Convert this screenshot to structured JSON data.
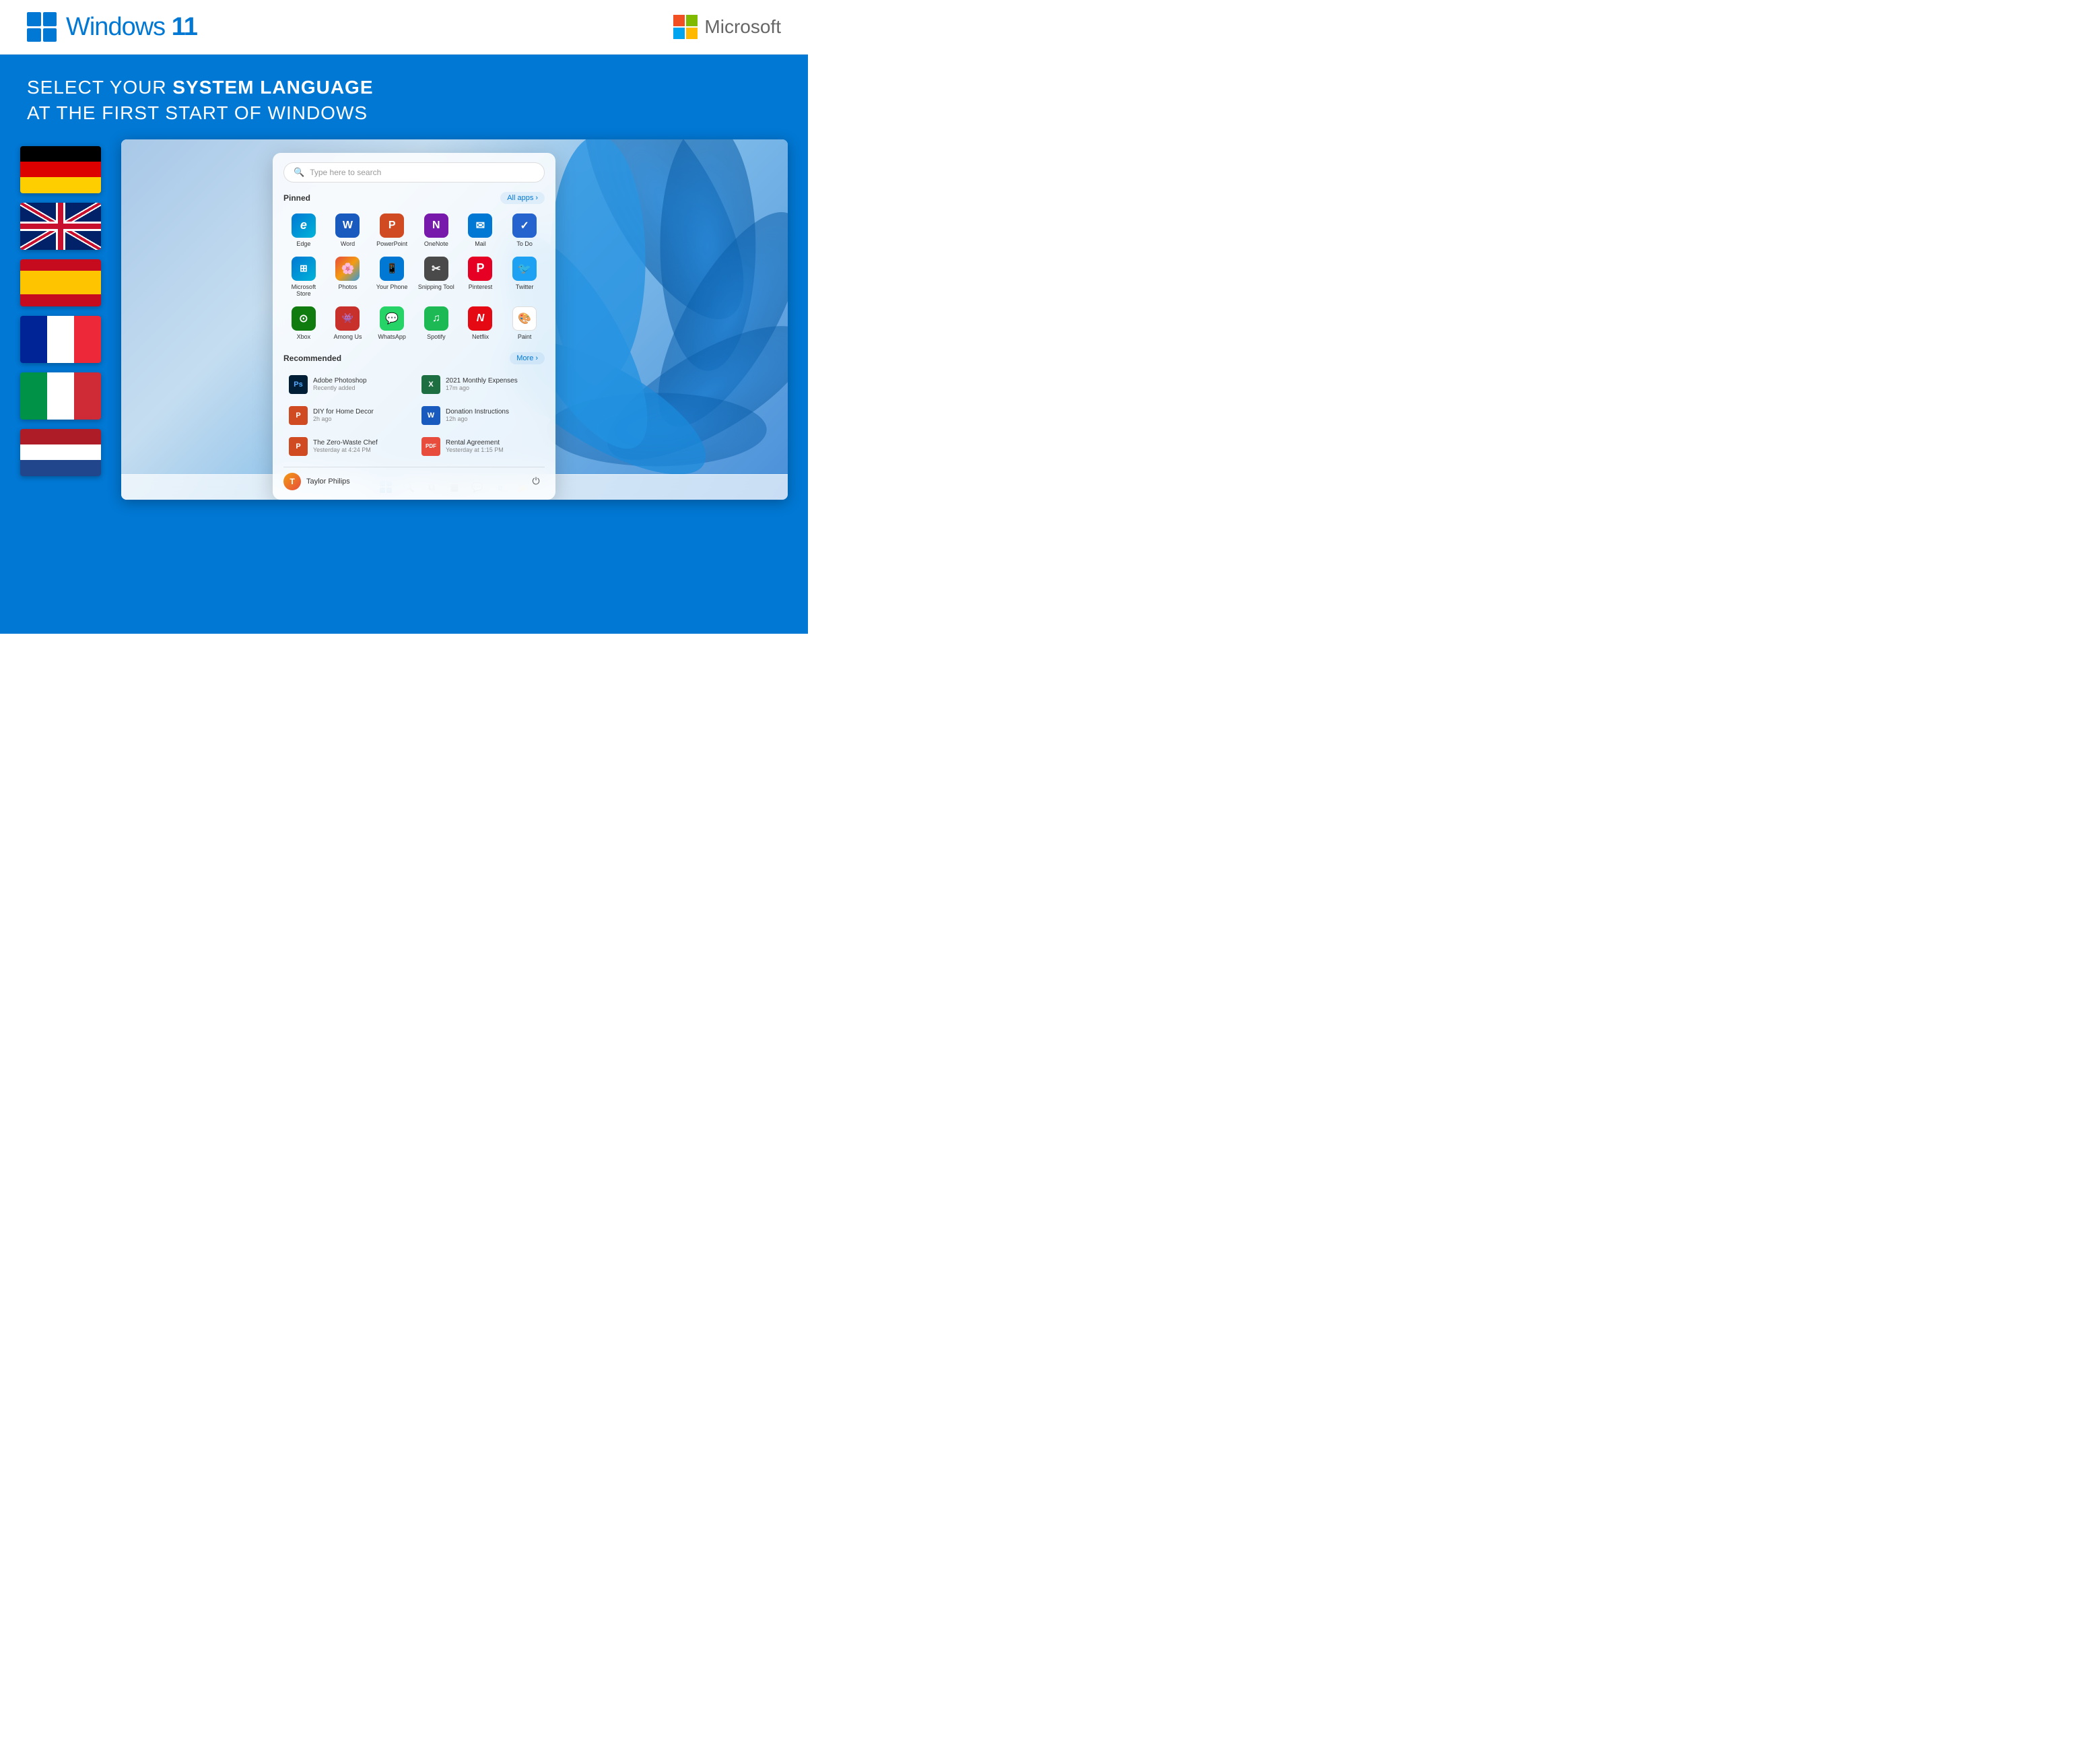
{
  "header": {
    "windows_logo": "Windows 11",
    "windows_title_light": "Windows ",
    "windows_title_bold": "11",
    "microsoft_title": "Microsoft"
  },
  "headline": {
    "line1_light": "SELECT YOUR ",
    "line1_bold": "SYSTEM LANGUAGE",
    "line2": "AT THE FIRST START OF WINDOWS"
  },
  "flags": [
    {
      "id": "de",
      "name": "German flag",
      "type": "de"
    },
    {
      "id": "uk",
      "name": "UK flag",
      "type": "uk"
    },
    {
      "id": "es",
      "name": "Spanish flag",
      "type": "es"
    },
    {
      "id": "fr",
      "name": "French flag",
      "type": "fr"
    },
    {
      "id": "it",
      "name": "Italian flag",
      "type": "it"
    },
    {
      "id": "nl",
      "name": "Netherlands flag",
      "type": "nl"
    }
  ],
  "start_menu": {
    "search_placeholder": "Type here to search",
    "pinned_label": "Pinned",
    "all_apps_label": "All apps",
    "recommended_label": "Recommended",
    "more_label": "More",
    "pinned_apps": [
      {
        "id": "edge",
        "label": "Edge",
        "icon": "e",
        "class": "icon-edge"
      },
      {
        "id": "word",
        "label": "Word",
        "icon": "W",
        "class": "icon-word"
      },
      {
        "id": "ppt",
        "label": "PowerPoint",
        "icon": "P",
        "class": "icon-ppt"
      },
      {
        "id": "onenote",
        "label": "OneNote",
        "icon": "N",
        "class": "icon-onenote"
      },
      {
        "id": "mail",
        "label": "Mail",
        "icon": "✉",
        "class": "icon-mail"
      },
      {
        "id": "todo",
        "label": "To Do",
        "icon": "✓",
        "class": "icon-todo"
      },
      {
        "id": "msstore",
        "label": "Microsoft Store",
        "icon": "⊞",
        "class": "icon-msstore"
      },
      {
        "id": "photos",
        "label": "Photos",
        "icon": "🌸",
        "class": "icon-photos"
      },
      {
        "id": "phone",
        "label": "Your Phone",
        "icon": "📱",
        "class": "icon-phone"
      },
      {
        "id": "snipping",
        "label": "Snipping Tool",
        "icon": "✂",
        "class": "icon-snipping"
      },
      {
        "id": "pinterest",
        "label": "Pinterest",
        "icon": "P",
        "class": "icon-pinterest"
      },
      {
        "id": "twitter",
        "label": "Twitter",
        "icon": "🐦",
        "class": "icon-twitter"
      },
      {
        "id": "xbox",
        "label": "Xbox",
        "icon": "⊙",
        "class": "icon-xbox"
      },
      {
        "id": "among",
        "label": "Among Us",
        "icon": "👾",
        "class": "icon-among"
      },
      {
        "id": "whatsapp",
        "label": "WhatsApp",
        "icon": "💬",
        "class": "icon-whatsapp"
      },
      {
        "id": "spotify",
        "label": "Spotify",
        "icon": "♫",
        "class": "icon-spotify"
      },
      {
        "id": "netflix",
        "label": "Netflix",
        "icon": "N",
        "class": "icon-netflix"
      },
      {
        "id": "paint",
        "label": "Paint",
        "icon": "🎨",
        "class": "icon-paint"
      }
    ],
    "recommended": [
      {
        "id": "photoshop",
        "name": "Adobe Photoshop",
        "time": "Recently added",
        "icon": "Ps",
        "bg": "#001e36",
        "color": "#4faaff"
      },
      {
        "id": "expenses",
        "name": "2021 Monthly Expenses",
        "time": "17m ago",
        "icon": "X",
        "bg": "#1d6f42",
        "color": "#fff"
      },
      {
        "id": "diy",
        "name": "DIY for Home Decor",
        "time": "2h ago",
        "icon": "P",
        "bg": "#d04b22",
        "color": "#fff"
      },
      {
        "id": "donation",
        "name": "Donation Instructions",
        "time": "12h ago",
        "icon": "W",
        "bg": "#185abd",
        "color": "#fff"
      },
      {
        "id": "zerowaste",
        "name": "The Zero-Waste Chef",
        "time": "Yesterday at 4:24 PM",
        "icon": "P",
        "bg": "#d04b22",
        "color": "#fff"
      },
      {
        "id": "rental",
        "name": "Rental Agreement",
        "time": "Yesterday at 1:15 PM",
        "icon": "PDF",
        "bg": "#e74c3c",
        "color": "#fff"
      }
    ],
    "user": {
      "name": "Taylor Philips",
      "avatar_letter": "T"
    }
  }
}
